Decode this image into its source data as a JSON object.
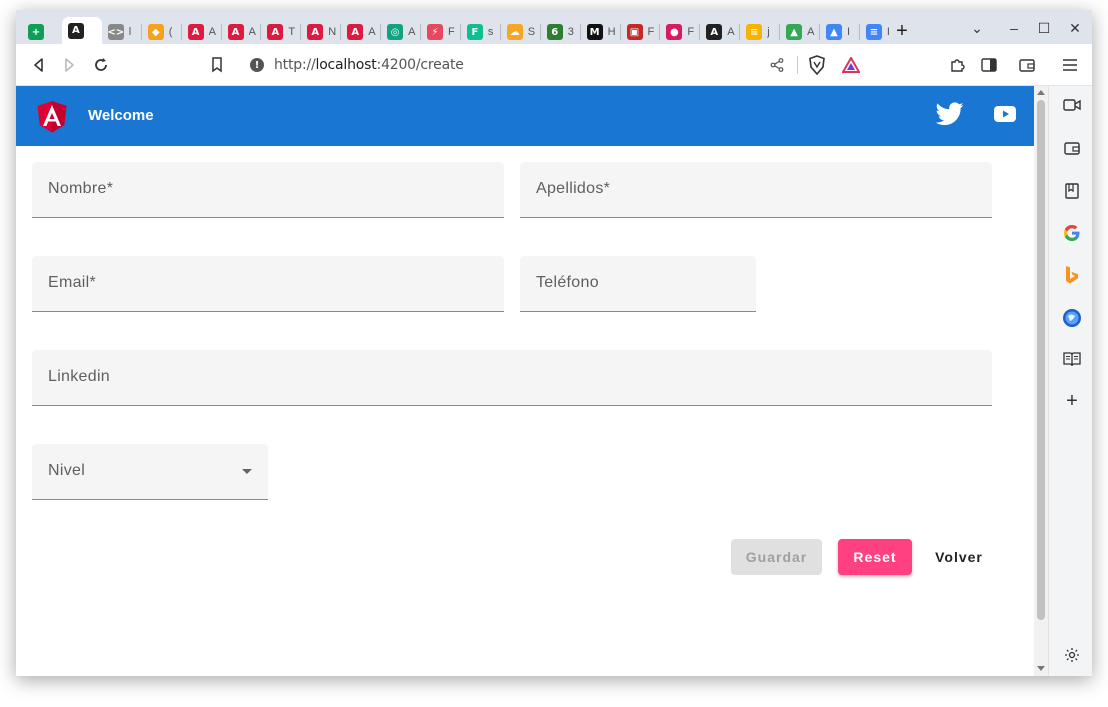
{
  "browser": {
    "tabs": [
      {
        "icon": "sheets-icon",
        "color": "#0f9d58",
        "glyph": "+",
        "title": "",
        "active": false
      },
      {
        "icon": "angular-icon",
        "color": "#222222",
        "glyph": "A",
        "title": "",
        "active": true
      },
      {
        "icon": "code-icon",
        "color": "#888888",
        "glyph": "<>",
        "title": "l",
        "active": false
      },
      {
        "icon": "shield-icon",
        "color": "#f7a21c",
        "glyph": "◆",
        "title": "(",
        "active": false
      },
      {
        "icon": "angular-icon",
        "color": "#dd1b3e",
        "glyph": "A",
        "title": "A",
        "active": false
      },
      {
        "icon": "angular-icon",
        "color": "#dd1b3e",
        "glyph": "A",
        "title": "A",
        "active": false
      },
      {
        "icon": "angular-icon",
        "color": "#dd1b3e",
        "glyph": "A",
        "title": "T",
        "active": false
      },
      {
        "icon": "angular-icon",
        "color": "#dd1b3e",
        "glyph": "A",
        "title": "N",
        "active": false
      },
      {
        "icon": "angular-icon",
        "color": "#dd1b3e",
        "glyph": "A",
        "title": "A",
        "active": false
      },
      {
        "icon": "openai-icon",
        "color": "#10a37f",
        "glyph": "◎",
        "title": "A",
        "active": false
      },
      {
        "icon": "pinterest-icon",
        "color": "#e8475f",
        "glyph": "⚡",
        "title": "F",
        "active": false
      },
      {
        "icon": "f-icon",
        "color": "#0fbf8f",
        "glyph": "F",
        "title": "s",
        "active": false
      },
      {
        "icon": "cloud-icon",
        "color": "#f5a623",
        "glyph": "☁",
        "title": "S",
        "active": false
      },
      {
        "icon": "mongo-icon",
        "color": "#2e7d32",
        "glyph": "6",
        "title": "3",
        "active": false
      },
      {
        "icon": "medium-icon",
        "color": "#111111",
        "glyph": "M",
        "title": "H",
        "active": false
      },
      {
        "icon": "bookmark-icon",
        "color": "#c62828",
        "glyph": "▣",
        "title": "F",
        "active": false
      },
      {
        "icon": "circle-icon",
        "color": "#d81b60",
        "glyph": "●",
        "title": "F",
        "active": false
      },
      {
        "icon": "angular-icon",
        "color": "#222222",
        "glyph": "A",
        "title": "A",
        "active": false
      },
      {
        "icon": "stack-icon",
        "color": "#f4b400",
        "glyph": "≡",
        "title": "j",
        "active": false
      },
      {
        "icon": "drive-icon",
        "color": "#34a853",
        "glyph": "▲",
        "title": "A",
        "active": false
      },
      {
        "icon": "drive-icon",
        "color": "#4285f4",
        "glyph": "▲",
        "title": "I",
        "active": false
      },
      {
        "icon": "docs-icon",
        "color": "#4285f4",
        "glyph": "≡",
        "title": "I",
        "active": false
      }
    ],
    "url_scheme": "http://",
    "url_host": "localhost",
    "url_rest": ":4200/create"
  },
  "app": {
    "title": "Welcome"
  },
  "form": {
    "nombre_label": "Nombre*",
    "apellidos_label": "Apellidos*",
    "email_label": "Email*",
    "telefono_label": "Teléfono",
    "linkedin_label": "Linkedin",
    "nivel_label": "Nivel"
  },
  "actions": {
    "save_label": "Guardar",
    "reset_label": "Reset",
    "back_label": "Volver"
  }
}
